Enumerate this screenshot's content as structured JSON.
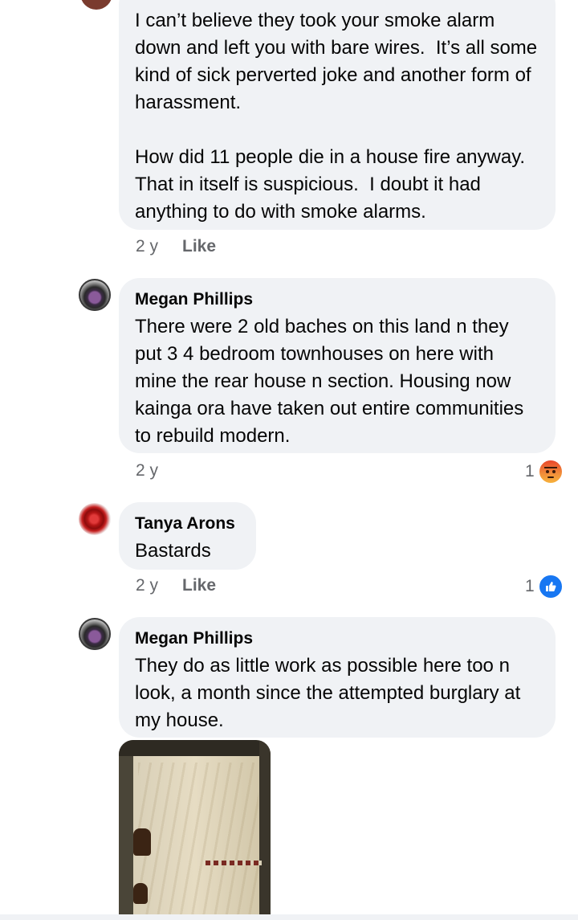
{
  "comments": [
    {
      "author": "",
      "text": "I can’t believe they took your smoke alarm down and left you with bare wires.  It’s all some kind of sick perverted joke and another form of harassment.\n\nHow did 11 people die in a house fire anyway.  That in itself is suspicious.  I doubt it had anything to do with smoke alarms.",
      "time": "2 y",
      "like_label": "Like"
    },
    {
      "author": "Megan Phillips",
      "text": "There were 2 old baches on this land n they put 3 4 bedroom townhouses on here with mine the rear house n section. Housing now kainga ora have taken out entire communities to rebuild modern.",
      "time": "2 y",
      "reaction_count": "1",
      "reaction_icon": "angry-reaction-icon"
    },
    {
      "author": "Tanya Arons",
      "text": "Bastards",
      "time": "2 y",
      "like_label": "Like",
      "reaction_count": "1",
      "reaction_icon": "like-reaction-icon"
    },
    {
      "author": "Megan Phillips",
      "text": "They do as little work as possible here too n look, a month since the attempted burglary at my house."
    }
  ],
  "colors": {
    "bubble": "#f0f2f5",
    "meta_text": "#65676b",
    "like_blue": "#1877f2",
    "angry_orange": "#f18f3a"
  }
}
